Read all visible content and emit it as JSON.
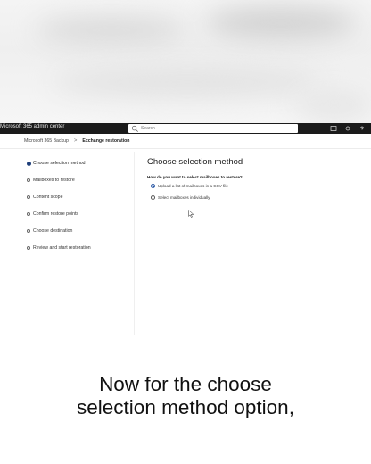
{
  "topbar": {
    "app_title": "Microsoft 365 admin center",
    "search_placeholder": "Search"
  },
  "breadcrumb": {
    "items": [
      "Microsoft 365 Backup",
      "Exchange restoration"
    ],
    "separator": ">"
  },
  "steps": [
    {
      "label": "Choose selection method",
      "active": true
    },
    {
      "label": "Mailboxes to restore",
      "active": false
    },
    {
      "label": "Content scope",
      "active": false
    },
    {
      "label": "Confirm restore points",
      "active": false
    },
    {
      "label": "Choose destination",
      "active": false
    },
    {
      "label": "Review and start restoration",
      "active": false
    }
  ],
  "main": {
    "title": "Choose selection method",
    "question": "How do you want to select mailboxes to restore?",
    "options": [
      {
        "label": "Upload a list of mailboxes in a CSV file",
        "checked": true
      },
      {
        "label": "Select mailboxes individually",
        "checked": false
      }
    ]
  },
  "caption": {
    "line1": "Now for the choose",
    "line2": "selection method option,"
  },
  "colors": {
    "topbar_bg": "#1b1b1b",
    "accent": "#1f4fa0",
    "active_step": "#1f3f7a"
  }
}
